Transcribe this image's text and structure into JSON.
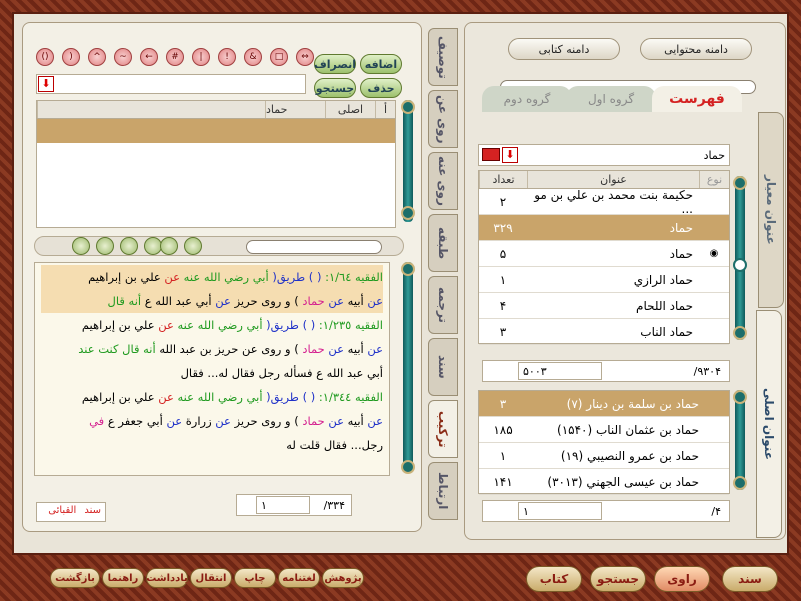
{
  "colors": {
    "accent": "#8a1c12",
    "highlight": "#c9a46a",
    "spine": "#1c6e6a"
  },
  "top_close_icon": "arrow-right-icon",
  "right": {
    "top_buttons": [
      "دامنه محتوایی",
      "دامنه کتابی"
    ],
    "group_tabs": {
      "index": "فهرست",
      "group1": "گروه اول",
      "group2": "گروه دوم"
    },
    "search_value": "حماد",
    "side_tabs": {
      "standard_title": "عنوان معیار",
      "original_title": "عنوان اصلی"
    },
    "table": {
      "headers": {
        "type": "نوع",
        "title": "عنوان",
        "count": "تعداد"
      },
      "rows": [
        {
          "title": "حکیمة بنت محمد بن علي بن مو ...",
          "count": "۲"
        },
        {
          "title": "حماد",
          "count": "۳۲۹"
        },
        {
          "title": "حماد",
          "count": "۵"
        },
        {
          "title": "حماد الرازي",
          "count": "۱"
        },
        {
          "title": "حماد اللحام",
          "count": "۴"
        },
        {
          "title": "حماد الناب",
          "count": "۳"
        }
      ]
    },
    "footer1": {
      "total": "/۹۳۰۴",
      "current": "۵۰۰۳"
    },
    "table2": {
      "rows": [
        {
          "title": "حماد بن سلمة بن دينار (۷)",
          "count": "۳"
        },
        {
          "title": "حماد بن عثمان الناب (۱۵۴۰)",
          "count": "۱۸۵"
        },
        {
          "title": "حماد بن عمرو النصيبي (۱۹)",
          "count": "۱"
        },
        {
          "title": "حماد بن عيسى الجهني (۳۰۱۳)",
          "count": "۱۴۱"
        }
      ]
    },
    "footer2": {
      "total": "/۴",
      "current": "۱"
    }
  },
  "left": {
    "buttons": {
      "add": "اضافه",
      "remove": "انصراف",
      "delete": "حذف",
      "search": "جستجو"
    },
    "table_headers": {
      "a": "أ",
      "original": "اصلی",
      "word": "حماد"
    },
    "vtabs": [
      "توصيف",
      "روى عن",
      "روى عنه",
      "طبقه",
      "ترجمه",
      "سند",
      "تركيب",
      "ارتباط"
    ],
    "active_vtab": 6,
    "text_lines": [
      {
        "parts": [
          {
            "t": "الفقيه ١/٦٤: ",
            "c": "green"
          },
          {
            "t": "( ) طريق( ",
            "c": "blue"
          },
          {
            "t": "أبي رضي الله عنه ",
            "c": "green"
          },
          {
            "t": "عن ",
            "c": "red"
          },
          {
            "t": "علي بن إبراهيم",
            "c": "black"
          }
        ],
        "hl": true
      },
      {
        "parts": [
          {
            "t": "عن ",
            "c": "blue"
          },
          {
            "t": "أبيه ",
            "c": "black"
          },
          {
            "t": "عن ",
            "c": "blue"
          },
          {
            "t": "حماد",
            "c": "pink"
          },
          {
            "t": " ) و روى ",
            "c": "black"
          },
          {
            "t": "حريز ",
            "c": "black"
          },
          {
            "t": "عن ",
            "c": "blue"
          },
          {
            "t": "أبي عبد الله ع ",
            "c": "black"
          },
          {
            "t": "أنه قال",
            "c": "green"
          }
        ],
        "hl": true
      },
      {
        "parts": [
          {
            "t": "الفقيه ١/٢٣٥: ",
            "c": "green"
          },
          {
            "t": "( ) طريق( ",
            "c": "blue"
          },
          {
            "t": "أبي رضي الله عنه ",
            "c": "green"
          },
          {
            "t": "عن ",
            "c": "red"
          },
          {
            "t": "علي بن إبراهيم",
            "c": "black"
          }
        ],
        "hl": false
      },
      {
        "parts": [
          {
            "t": "عن ",
            "c": "blue"
          },
          {
            "t": "أبيه ",
            "c": "black"
          },
          {
            "t": "عن ",
            "c": "blue"
          },
          {
            "t": "حماد",
            "c": "pink"
          },
          {
            "t": " ) و روى عن ",
            "c": "black"
          },
          {
            "t": "حريز بن عبد الله ",
            "c": "black"
          },
          {
            "t": "أنه قال كنت عند",
            "c": "green"
          }
        ],
        "hl": false
      },
      {
        "parts": [
          {
            "t": "أبي عبد الله ع فسأله رجل فقال له... فقال",
            "c": "black"
          }
        ],
        "hl": false
      },
      {
        "parts": [
          {
            "t": "الفقيه ١/٣٤٤: ",
            "c": "green"
          },
          {
            "t": "( ) طريق( ",
            "c": "blue"
          },
          {
            "t": "أبي رضي الله عنه ",
            "c": "green"
          },
          {
            "t": "عن ",
            "c": "red"
          },
          {
            "t": "علي بن إبراهيم",
            "c": "black"
          }
        ],
        "hl": false
      },
      {
        "parts": [
          {
            "t": "عن ",
            "c": "blue"
          },
          {
            "t": "أبيه ",
            "c": "black"
          },
          {
            "t": "عن ",
            "c": "blue"
          },
          {
            "t": "حماد",
            "c": "pink"
          },
          {
            "t": " ) و روى ",
            "c": "black"
          },
          {
            "t": "حريز ",
            "c": "black"
          },
          {
            "t": "عن ",
            "c": "blue"
          },
          {
            "t": "زرارة ",
            "c": "black"
          },
          {
            "t": "عن ",
            "c": "blue"
          },
          {
            "t": "أبي جعفر ع ",
            "c": "black"
          },
          {
            "t": "في",
            "c": "pink"
          }
        ],
        "hl": false
      },
      {
        "parts": [
          {
            "t": "رجل... فقال قلت له",
            "c": "black"
          }
        ],
        "hl": false
      }
    ],
    "footer": {
      "total": "/۳۳۴",
      "current": "۱"
    },
    "bottom_labels": {
      "a": "القبائی",
      "b": "سند"
    }
  },
  "bottom_bar": {
    "right_buttons": [
      "سند",
      "راوی",
      "جستجو",
      "کتاب"
    ],
    "left_buttons": [
      "پژوهش",
      "لغتنامه",
      "چاپ",
      "انتقال",
      "یادداشت",
      "راهنما",
      "بازگشت"
    ]
  }
}
